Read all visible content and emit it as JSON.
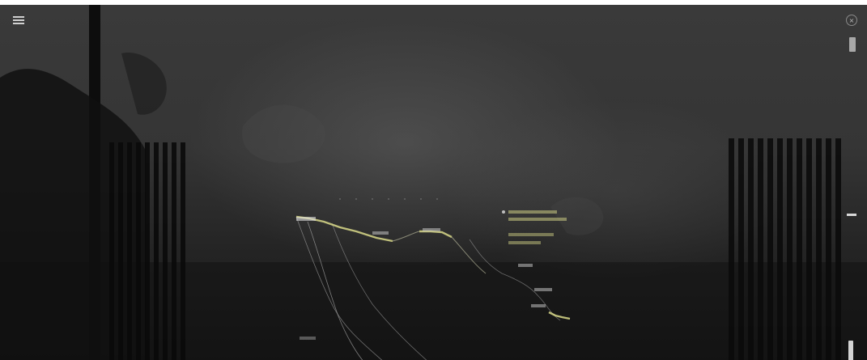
{
  "header": {
    "publication": "",
    "subtitle": "",
    "close_glyph": "×"
  },
  "article": {
    "title": "",
    "byline": "",
    "paragraphs": [
      "",
      ""
    ]
  },
  "map": {
    "region_labels": [],
    "legend": []
  },
  "colors": {
    "background": "#2b2b2b",
    "text": "#e6e6e6",
    "accent_wall": "#d9d98a",
    "route_line": "#c8c8a8"
  },
  "icons": [
    "menu-icon",
    "close-icon",
    "bookmark-icon",
    "scroll-marker-icon",
    "scroll-thumb-icon"
  ]
}
